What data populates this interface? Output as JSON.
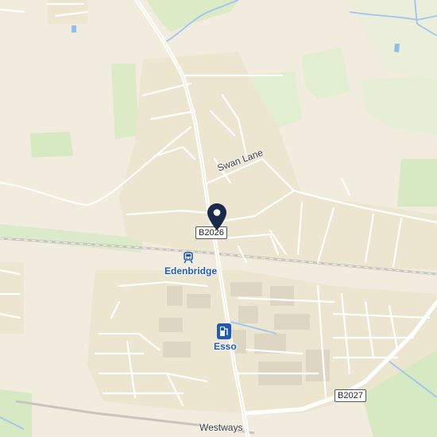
{
  "map": {
    "pin_color": "#1b2a4a",
    "poi_color": "#1e5bb8",
    "labels": {
      "swan_lane": "Swan Lane",
      "westways": "Westways"
    },
    "road_badges": {
      "b2026": "B2026",
      "b2027": "B2027"
    },
    "pois": {
      "station": {
        "name": "Edenbridge",
        "icon": "train-icon"
      },
      "fuel": {
        "name": "Esso",
        "icon": "fuel-pump-icon"
      }
    }
  }
}
